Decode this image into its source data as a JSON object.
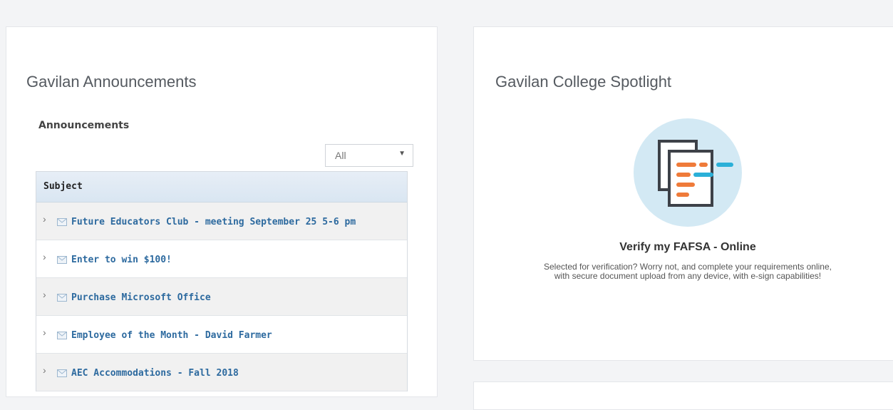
{
  "announcements": {
    "title": "Gavilan Announcements",
    "subheading": "Announcements",
    "filter": {
      "selected": "All"
    },
    "table": {
      "header": "Subject",
      "rows": [
        {
          "subject": "Future Educators Club - meeting September 25 5-6 pm"
        },
        {
          "subject": "Enter to win $100!"
        },
        {
          "subject": "Purchase Microsoft Office"
        },
        {
          "subject": "Employee of the Month - David Farmer"
        },
        {
          "subject": "AEC Accommodations - Fall 2018"
        }
      ]
    }
  },
  "spotlight": {
    "title": "Gavilan College Spotlight",
    "icon": "document-verification-icon",
    "heading": "Verify my FAFSA - Online",
    "desc_line1": "Selected for verification? Worry not, and complete your requirements online,",
    "desc_line2": "with secure document upload from any device, with e-sign capabilities!"
  },
  "colors": {
    "link": "#2d6a9f",
    "header_bg": "#dde8f3",
    "icon_circle": "#d3e9f4",
    "orange": "#ef7b3a",
    "cyan": "#2bb0d8"
  }
}
